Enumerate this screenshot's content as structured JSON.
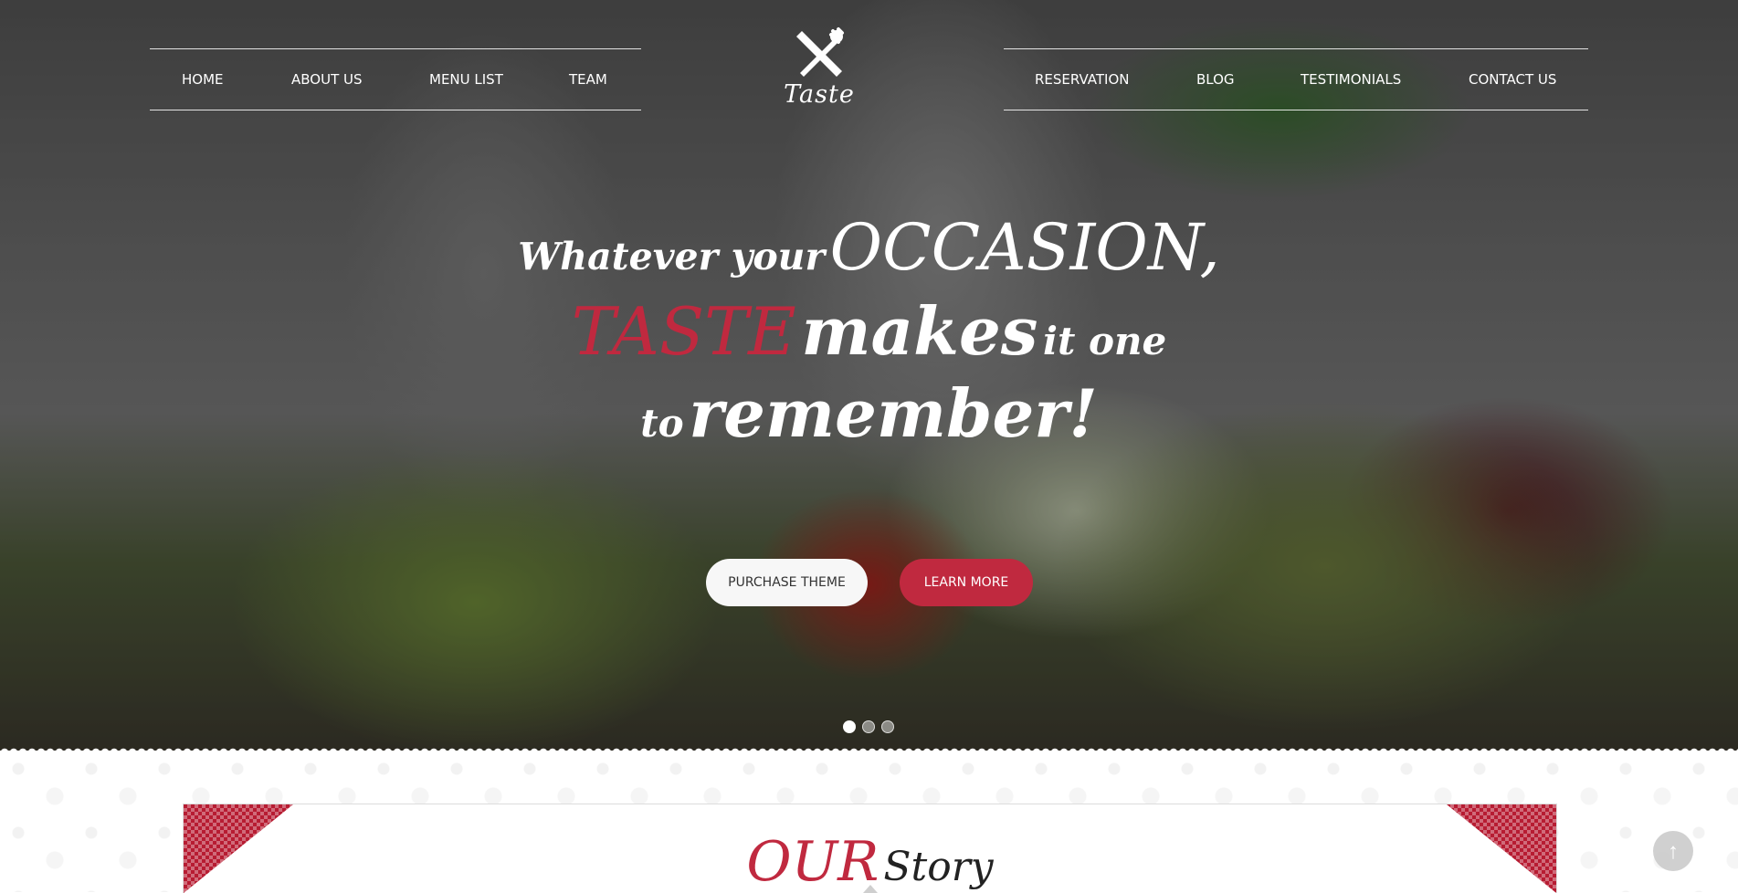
{
  "nav": {
    "left": [
      "HOME",
      "ABOUT US",
      "MENU LIST",
      "TEAM"
    ],
    "right": [
      "RESERVATION",
      "BLOG",
      "TESTIMONIALS",
      "CONTACT US"
    ]
  },
  "logo": {
    "text": "Taste",
    "icon": "fork-knife-icon"
  },
  "hero": {
    "line1_small": "Whatever your",
    "line1_big": "OCCASION,",
    "line2_accent": "TASTE",
    "line2_big": "makes",
    "line2_small": "it one",
    "line3_small": "to",
    "line3_big": "remember!",
    "buttons": {
      "purchase": "PURCHASE THEME",
      "learn": "LEARN MORE"
    },
    "slides": {
      "count": 3,
      "active": 1
    }
  },
  "story": {
    "accent": "OUR",
    "rest": "Story"
  },
  "scroll_top": {
    "icon": "arrow-up-icon"
  },
  "colors": {
    "accent": "#c0293f",
    "checker": "#b71c32"
  }
}
